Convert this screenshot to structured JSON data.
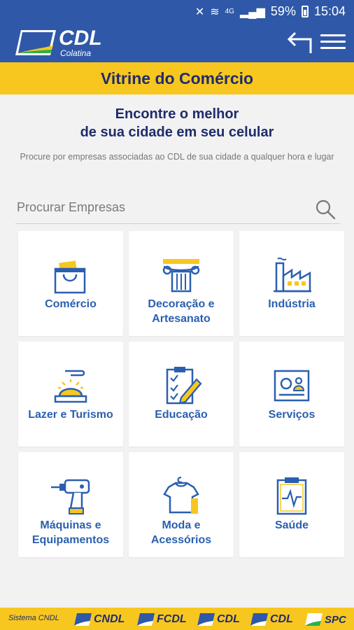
{
  "status_bar": {
    "signal": "4G",
    "battery": "59%",
    "time": "15:04"
  },
  "header": {
    "logo_title": "CDL",
    "logo_subtitle": "Colatina"
  },
  "title": "Vitrine do Comércio",
  "intro": {
    "line1": "Encontre o melhor",
    "line2": "de sua cidade em seu celular",
    "description": "Procure por empresas associadas ao CDL de sua cidade a qualquer hora e lugar"
  },
  "search": {
    "placeholder": "Procurar Empresas"
  },
  "categories": [
    {
      "label": "Comércio",
      "icon": "shopping-bag-icon"
    },
    {
      "label": "Decoração e Artesanato",
      "icon": "column-icon"
    },
    {
      "label": "Indústria",
      "icon": "factory-icon"
    },
    {
      "label": "Lazer e Turismo",
      "icon": "service-bell-icon"
    },
    {
      "label": "Educação",
      "icon": "checklist-pencil-icon"
    },
    {
      "label": "Serviços",
      "icon": "id-card-icon"
    },
    {
      "label": "Máquinas e Equipamentos",
      "icon": "drill-icon"
    },
    {
      "label": "Moda e Acessórios",
      "icon": "shirt-hanger-icon"
    },
    {
      "label": "Saúde",
      "icon": "clipboard-heartbeat-icon"
    }
  ],
  "footer": {
    "system_label": "Sistema CNDL",
    "brands": [
      "CNDL",
      "FCDL",
      "CDL",
      "CDL",
      "SPC"
    ]
  },
  "colors": {
    "primary": "#2f58a8",
    "accent": "#f7c720",
    "navy": "#1f2c6b",
    "label": "#2a5fb0"
  }
}
